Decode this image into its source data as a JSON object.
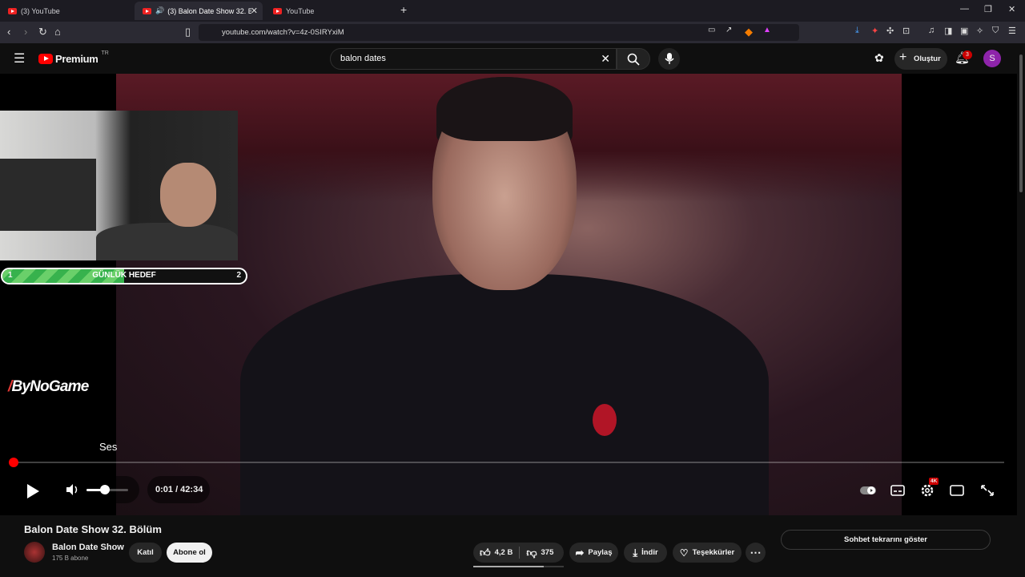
{
  "browser": {
    "tabs": [
      {
        "label": "(3) YouTube"
      },
      {
        "label": "(3) Balon Date Show 32. Bölü"
      },
      {
        "label": "YouTube"
      }
    ],
    "url": "youtube.com/watch?v=4z-0SIRYxiM"
  },
  "youtube": {
    "logo_text": "Premium",
    "logo_region": "TR",
    "search_value": "balon dates",
    "create_label": "Oluştur",
    "notification_count": "3",
    "avatar_letter": "S"
  },
  "overlay": {
    "goal_left": "1",
    "goal_label": "GÜNLÜK HEDEF",
    "goal_right": "2",
    "goal_progress": 0.5,
    "brand": "ByNoGame",
    "volume_tooltip": "Ses"
  },
  "player": {
    "time": "0:01 / 42:34",
    "progress": 0.0,
    "volume": 0.45,
    "quality_badge": "4K"
  },
  "video": {
    "title": "Balon Date Show 32. Bölüm",
    "channel": "Balon Date Show",
    "subscribers": "175 B abone",
    "join_label": "Katıl",
    "subscribe_label": "Abone ol",
    "likes": "4,2 B",
    "dislikes": "375",
    "share_label": "Paylaş",
    "download_label": "İndir",
    "thanks_label": "Teşekkürler",
    "chat_replay_label": "Sohbet tekrarını göster"
  },
  "colors": {
    "accent": "#ff0000",
    "background": "#0f0f0f",
    "goal_green": "#37b24d"
  }
}
